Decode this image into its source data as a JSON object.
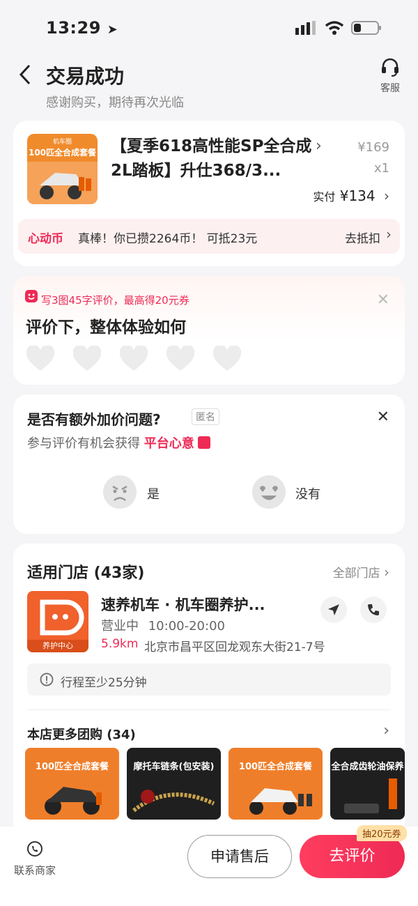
{
  "status_bar": {
    "time": "13:29"
  },
  "header": {
    "title": "交易成功",
    "subtitle": "感谢购买，期待再次光临",
    "service_label": "客服"
  },
  "product": {
    "thumb_title": "100匹全合成套餐",
    "thumb_brand": "机车圈",
    "title": "【夏季618高性能SP全合成2L踏板】升仕368/3...",
    "price": "¥169",
    "qty": "x1",
    "paid_label": "实付",
    "paid_value": "¥134"
  },
  "coin": {
    "label": "心动币",
    "text": "真棒！你已攒2264币！ 可抵23元",
    "action": "去抵扣"
  },
  "review": {
    "hint": "写3图45字评价，最高得20元券",
    "title": "评价下，整体体验如何"
  },
  "extra_price": {
    "title": "是否有额外加价问题?",
    "anon": "匿名",
    "sub": "参与评价有机会获得",
    "sub_red": "平台心意",
    "yes": "是",
    "no": "没有"
  },
  "store": {
    "title": "适用门店 (43家)",
    "all": "全部门店",
    "logo_label": "养护中心",
    "name": "速养机车 · 机车圈养护...",
    "status": "营业中",
    "hours": "10:00-20:00",
    "distance": "5.9km",
    "address": "北京市昌平区回龙观东大街21-7号",
    "trip": "行程至少25分钟",
    "more_title": "本店更多团购 (34)"
  },
  "tiles": [
    {
      "label": "100匹全合成套餐",
      "style": "orange"
    },
    {
      "label": "摩托车链条(包安装)",
      "style": "dark"
    },
    {
      "label": "100匹全合成套餐",
      "style": "orange"
    },
    {
      "label": "全合成齿轮油保养",
      "style": "dark"
    }
  ],
  "bottom": {
    "contact": "联系商家",
    "after_sale": "申请售后",
    "review": "去评价",
    "badge": "抽20元券"
  },
  "colors": {
    "accent": "#ee2a55",
    "brand_orange": "#f08b2c"
  }
}
